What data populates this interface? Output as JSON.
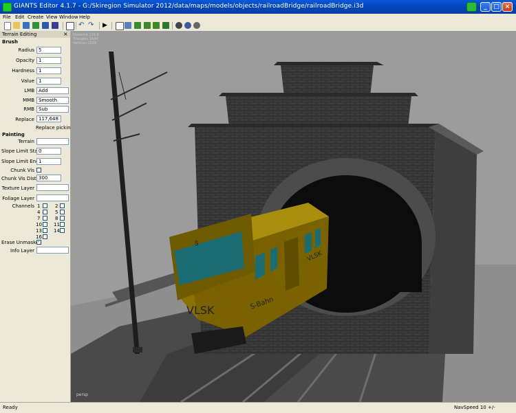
{
  "window": {
    "title": "GIANTS Editor 4.1.7 - G:/Skiregion Simulator 2012/data/maps/models/objects/railroadBridge/railroadBridge.i3d",
    "minimize": "_",
    "maximize": "□",
    "close": "×"
  },
  "menu": [
    "File",
    "Edit",
    "Create",
    "View",
    "Window",
    "Help"
  ],
  "panel": {
    "title": "Terrain Editing",
    "close": "×",
    "brush_title": "Brush",
    "radius": {
      "label": "Radius",
      "value": "5"
    },
    "opacity": {
      "label": "Opacity",
      "value": "1"
    },
    "hardness": {
      "label": "Hardness",
      "value": "1"
    },
    "value": {
      "label": "Value",
      "value": "1"
    },
    "lmb": {
      "label": "LMB",
      "value": "Add"
    },
    "mmb": {
      "label": "MMB",
      "value": "Smooth"
    },
    "rmb": {
      "label": "RMB",
      "value": "Sub"
    },
    "replace": {
      "label": "Replace",
      "value": "117,648"
    },
    "replace_picking": "Replace picking: (",
    "painting_title": "Painting",
    "terrain": {
      "label": "Terrain",
      "value": ""
    },
    "slope_start": {
      "label": "Slope Limit Start",
      "value": "0"
    },
    "slope_end": {
      "label": "Slope Limit End",
      "value": "1"
    },
    "chunk_vis": {
      "label": "Chunk Vis"
    },
    "chunk_vis_dist": {
      "label": "Chunk Vis Dist",
      "value": "300"
    },
    "texture_layer": {
      "label": "Texture Layer",
      "value": ""
    },
    "foliage_layer": {
      "label": "Foliage Layer",
      "value": ""
    },
    "channels": {
      "label": "Channels",
      "items": [
        "1",
        "2",
        "4",
        "5",
        "7",
        "8",
        "10",
        "11",
        "13",
        "14",
        "16"
      ]
    },
    "erase_unmasked": {
      "label": "Erase Unmasked"
    },
    "info_layer": {
      "label": "Info Layer",
      "value": ""
    }
  },
  "viewport": {
    "stats": [
      "Distance 126.8",
      "Triangles 1644",
      "Vertices 1016"
    ],
    "camera": "persp",
    "train_text": {
      "vlsk": "VLSK",
      "sbahn": "S-Bahn",
      "side": "VLSK",
      "logo": "S"
    }
  },
  "status": {
    "left": "Ready",
    "navspeed": "NavSpeed 10 +/-"
  }
}
